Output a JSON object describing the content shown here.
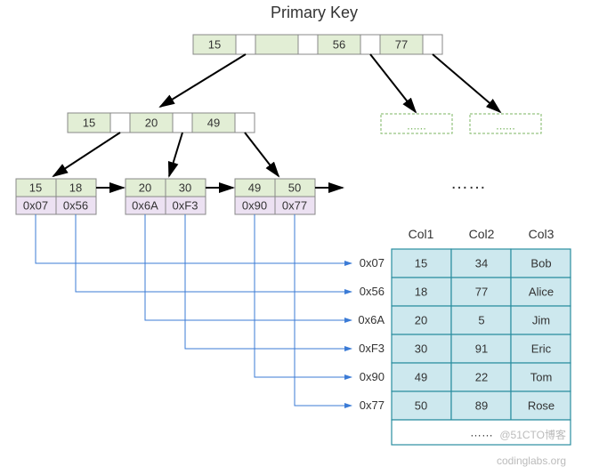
{
  "title": "Primary Key",
  "root": {
    "keys": [
      "15",
      "56",
      "77"
    ]
  },
  "level1": {
    "keys": [
      "15",
      "20",
      "49"
    ]
  },
  "dashed_nodes": [
    "......",
    "......"
  ],
  "leaves": [
    {
      "keys": [
        "15",
        "18"
      ],
      "ptrs": [
        "0x07",
        "0x56"
      ]
    },
    {
      "keys": [
        "20",
        "30"
      ],
      "ptrs": [
        "0x6A",
        "0xF3"
      ]
    },
    {
      "keys": [
        "49",
        "50"
      ],
      "ptrs": [
        "0x90",
        "0x77"
      ]
    }
  ],
  "leaf_ellipsis": "……",
  "addresses": [
    "0x07",
    "0x56",
    "0x6A",
    "0xF3",
    "0x90",
    "0x77"
  ],
  "table": {
    "headers": [
      "Col1",
      "Col2",
      "Col3"
    ],
    "rows": [
      [
        "15",
        "34",
        "Bob"
      ],
      [
        "18",
        "77",
        "Alice"
      ],
      [
        "20",
        "5",
        "Jim"
      ],
      [
        "30",
        "91",
        "Eric"
      ],
      [
        "49",
        "22",
        "Tom"
      ],
      [
        "50",
        "89",
        "Rose"
      ]
    ],
    "footer": "……"
  },
  "watermark1": "@51CTO博客",
  "watermark2": "codinglabs.org"
}
